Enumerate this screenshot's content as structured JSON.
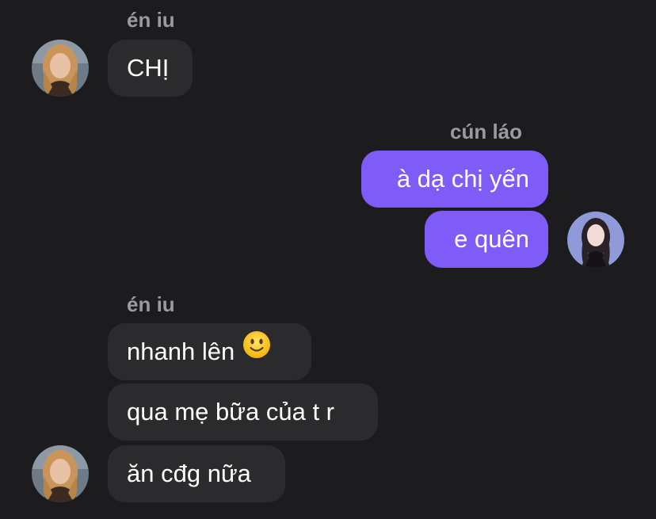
{
  "messages": [
    {
      "sender": "én iu",
      "text": "CHỊ"
    },
    {
      "sender": "cún láo",
      "text": "à dạ chị yến"
    },
    {
      "text": "e quên"
    },
    {
      "sender": "én iu",
      "text": "nhanh lên",
      "emoji": "slightly-smiling-face"
    },
    {
      "text": "qua mẹ bữa của t r"
    },
    {
      "text": "ăn cđg nữa"
    }
  ],
  "colors": {
    "background": "#1c1c1e",
    "incoming_bubble": "#2b2b2e",
    "outgoing_bubble": "#7f5cf7",
    "sender_name": "#9a9a9f",
    "text": "#ffffff"
  },
  "icons": {
    "contact_avatar": "avatar-blonde-woman",
    "self_avatar": "avatar-dark-haired-woman"
  }
}
